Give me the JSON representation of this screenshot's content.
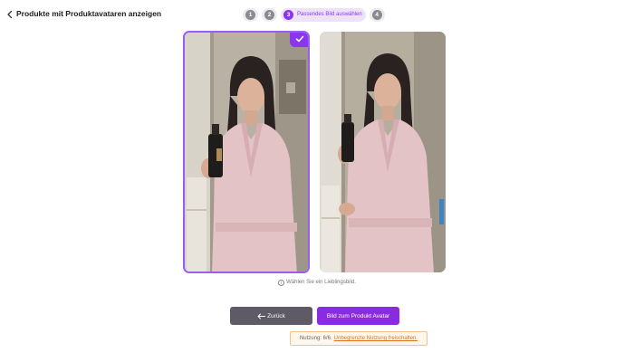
{
  "header": {
    "title": "Produkte mit Produktavataren anzeigen"
  },
  "stepper": {
    "steps": [
      {
        "num": "1"
      },
      {
        "num": "2"
      },
      {
        "num": "3",
        "label": "Passendes Bild auswählen"
      },
      {
        "num": "4"
      }
    ],
    "active_step": 3
  },
  "images": [
    {
      "selected": true
    },
    {
      "selected": false
    }
  ],
  "hint": "Wählen Sie ein Lieblingsbild.",
  "buttons": {
    "back_label": "Zurück",
    "next_label": "Bild zum Produkt Avatar"
  },
  "usage": {
    "text": "Nutzung: 6/6.",
    "link": "Unbegrenzte Nutzung freischalten."
  },
  "colors": {
    "accent": "#8b35ec",
    "back_button": "#5f5b66",
    "usage_border": "#f2c28a"
  }
}
